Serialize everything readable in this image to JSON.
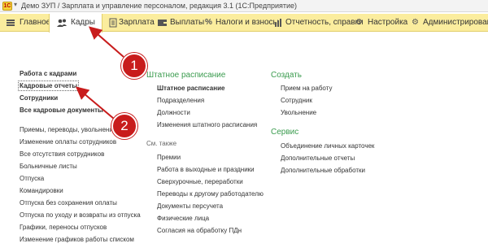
{
  "titlebar": {
    "logo": "1С",
    "caret": "▾",
    "title": "Демо ЗУП / Зарплата и управление персоналом, редакция 3.1 (1С:Предприятие)"
  },
  "menubar": {
    "items": [
      {
        "label": "Главное",
        "icon": "hamburger-icon"
      },
      {
        "label": "Кадры",
        "icon": "people-icon"
      },
      {
        "label": "Зарплата",
        "icon": "document-icon"
      },
      {
        "label": "Выплаты",
        "icon": "wallet-icon"
      },
      {
        "label": "Налоги и взносы",
        "icon": "percent-icon"
      },
      {
        "label": "Отчетность, справки",
        "icon": "chart-icon"
      },
      {
        "label": "Настройка",
        "icon": "gear-icon"
      },
      {
        "label": "Администрирование",
        "icon": "gear-icon"
      }
    ],
    "active_index": 1,
    "background": "#fbed9e"
  },
  "left_nav": {
    "main_links": [
      "Работа с кадрами",
      "Кадровые отчеты",
      "Сотрудники",
      "Все кадровые документы"
    ],
    "links": [
      "Приемы, переводы, увольнения",
      "Изменение оплаты сотрудников",
      "Все отсутствия сотрудников",
      "Больничные листы",
      "Отпуска",
      "Командировки",
      "Отпуска без сохранения оплаты",
      "Отпуска по уходу и возвраты из отпуска",
      "Графики, переносы отпусков",
      "Изменение графиков работы списком"
    ]
  },
  "center": {
    "section_title": "Штатное расписание",
    "links": [
      "Штатное расписание",
      "Подразделения",
      "Должности",
      "Изменения штатного расписания"
    ],
    "see_also_title": "См. также",
    "see_also_links": [
      "Премии",
      "Работа в выходные и праздники",
      "Сверхурочные, переработки",
      "Переводы к другому работодателю",
      "Документы персучета",
      "Физические лица",
      "Согласия на обработку ПДн"
    ]
  },
  "right": {
    "create_title": "Создать",
    "create_links": [
      "Прием на работу",
      "Сотрудник",
      "Увольнение"
    ],
    "service_title": "Сервис",
    "service_links": [
      "Объединение личных карточек",
      "Дополнительные отчеты",
      "Дополнительные обработки"
    ]
  },
  "callouts": [
    "1",
    "2"
  ],
  "colors": {
    "section_green": "#3a9b4e",
    "callout_red": "#c81c1c"
  }
}
